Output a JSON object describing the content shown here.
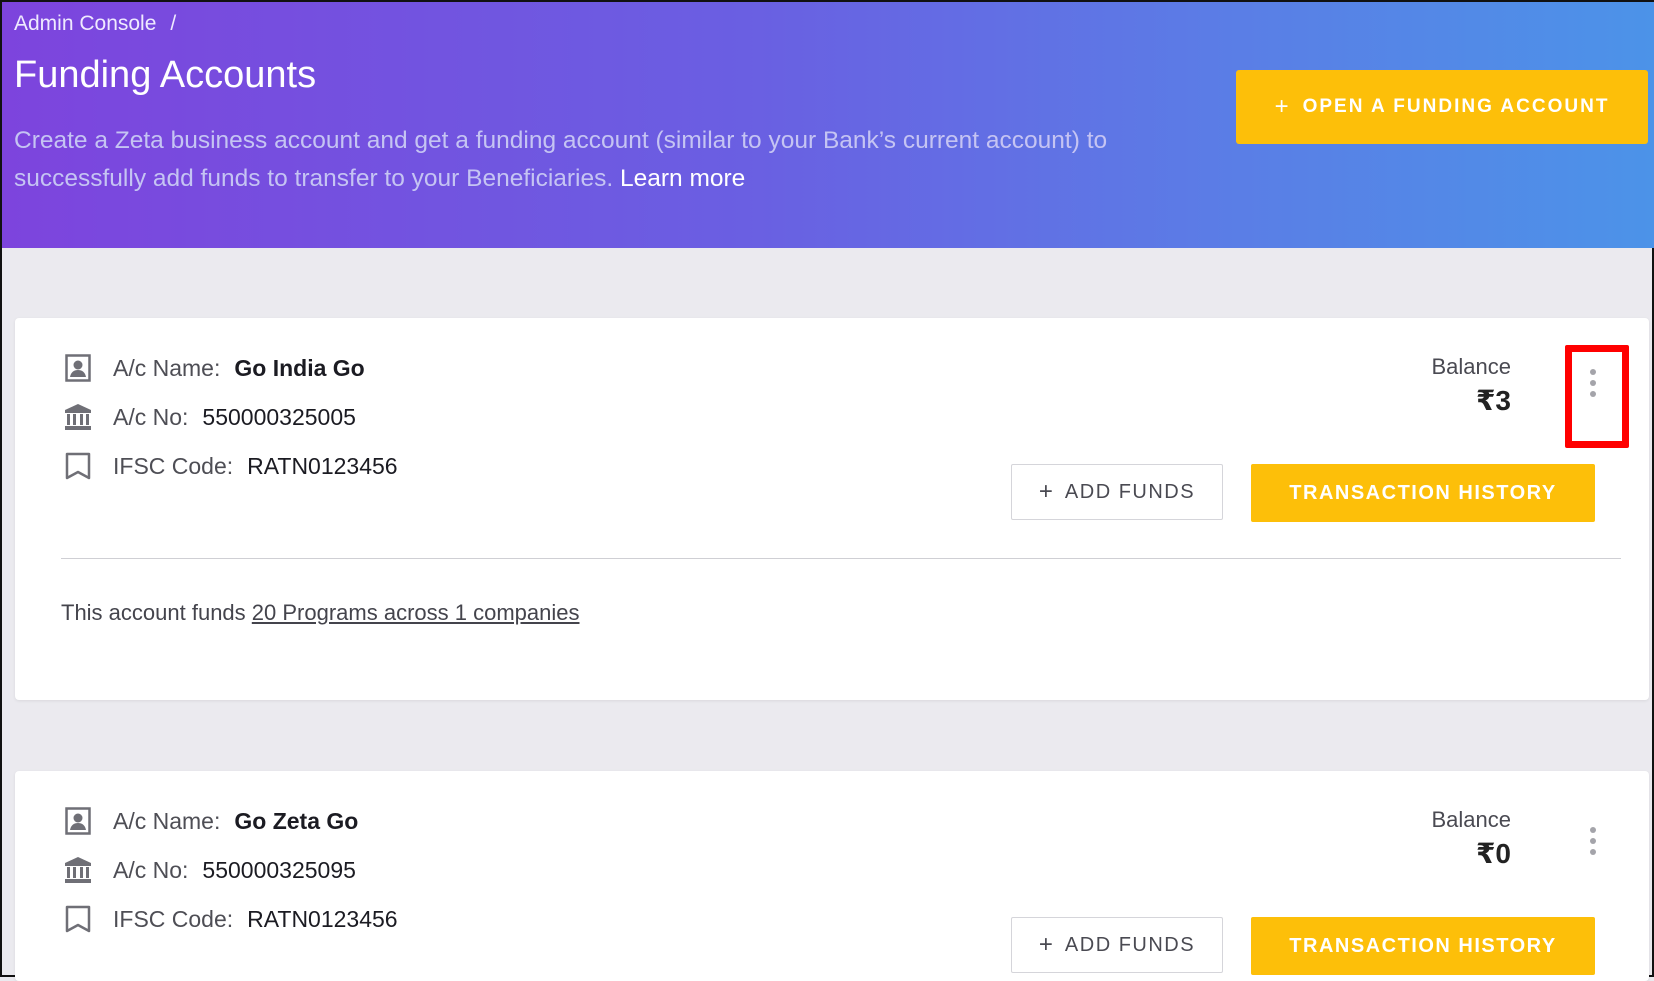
{
  "header": {
    "breadcrumb_root": "Admin Console",
    "breadcrumb_sep": "/",
    "title": "Funding Accounts",
    "description": "Create a Zeta business account and get a funding account (similar to your Bank’s current account) to successfully add funds to transfer to your Beneficiaries.",
    "learn_more": "Learn more",
    "open_account_label": "OPEN A FUNDING ACCOUNT"
  },
  "labels": {
    "name": "A/c Name:",
    "number": "A/c No:",
    "ifsc": "IFSC Code:",
    "balance": "Balance",
    "add_funds": "ADD FUNDS",
    "transaction_history": "TRANSACTION HISTORY",
    "plus": "+"
  },
  "accounts": [
    {
      "name": "Go India Go",
      "number": "550000325005",
      "ifsc": "RATN0123456",
      "balance": "₹3",
      "funds_prefix": "This account funds",
      "funds_link": "20 Programs across 1 companies"
    },
    {
      "name": "Go Zeta Go",
      "number": "550000325095",
      "ifsc": "RATN0123456",
      "balance": "₹0"
    }
  ],
  "colors": {
    "accent": "#fdbf09",
    "highlight": "#ff0000",
    "gradient_start": "#7d44dd",
    "gradient_end": "#4c93e8"
  }
}
